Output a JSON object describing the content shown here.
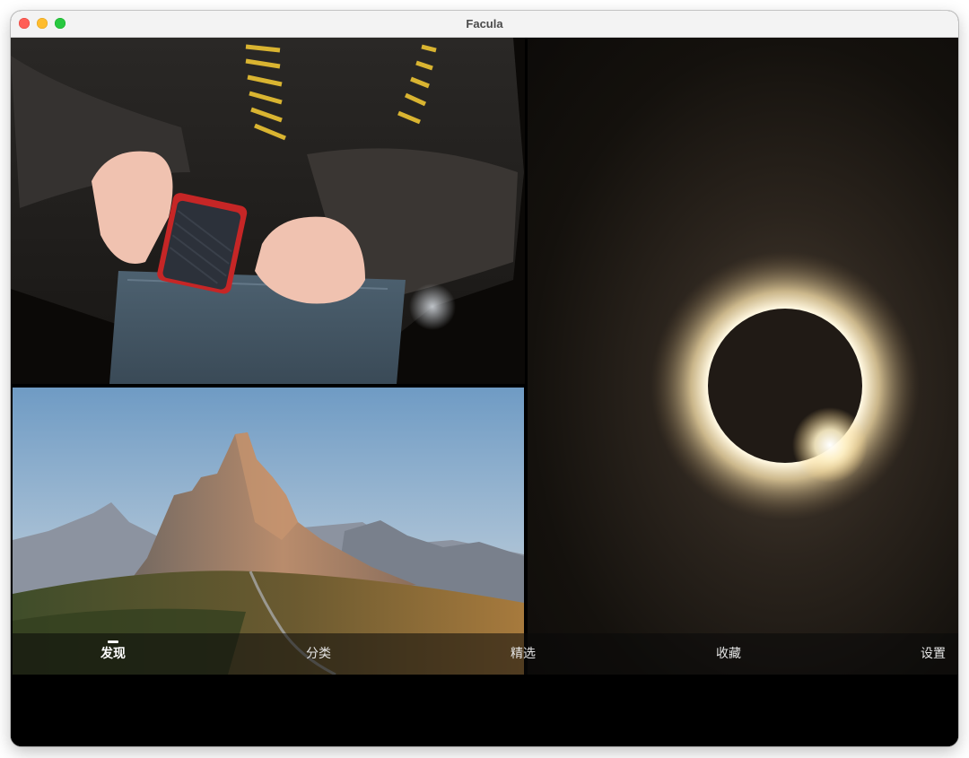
{
  "window": {
    "title": "Facula"
  },
  "photos": [
    {
      "subject": "person-jacket-red-ssd"
    },
    {
      "subject": "dolomite-mountain-road"
    },
    {
      "subject": "solar-eclipse-diamond-ring"
    }
  ],
  "tabs": [
    {
      "label": "发现",
      "active": true
    },
    {
      "label": "分类",
      "active": false
    },
    {
      "label": "精选",
      "active": false
    },
    {
      "label": "收藏",
      "active": false
    },
    {
      "label": "设置",
      "active": false
    }
  ],
  "colors": {
    "titlebar": "#f3f3f3",
    "close": "#ff5f57",
    "minimize": "#febc2e",
    "maximize": "#28c840",
    "background": "#000000"
  }
}
